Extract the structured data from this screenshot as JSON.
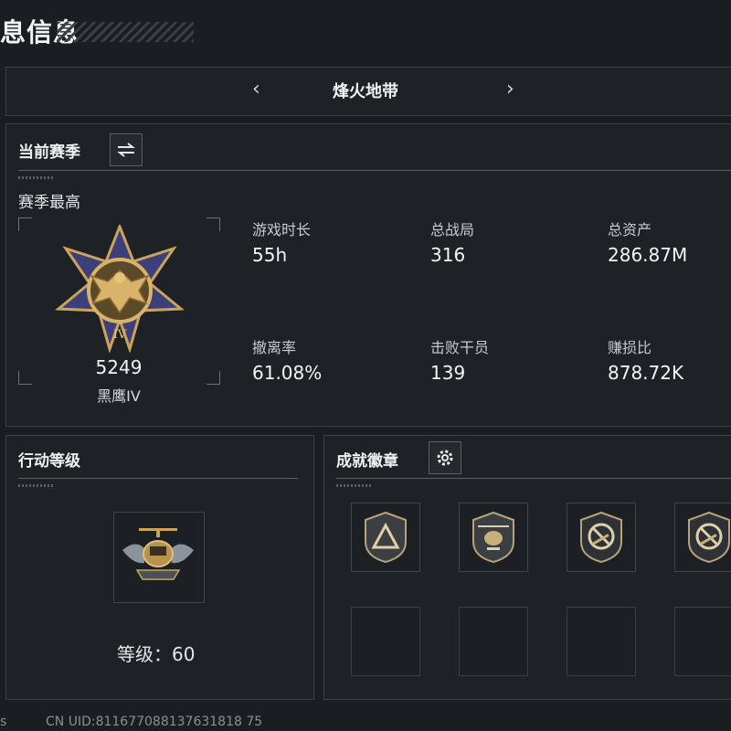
{
  "page": {
    "title": "息信息"
  },
  "mode_nav": {
    "mode_name": "烽火地带",
    "prev": "‹",
    "next": "›"
  },
  "season": {
    "header": "当前赛季",
    "swap_icon": "swap-arrows-icon",
    "best_label": "赛季最高",
    "rank_score": "5249",
    "rank_name": "黑鹰IV",
    "rank_emblem_numeral": "IV",
    "stats": [
      {
        "label": "游戏时长",
        "value": "55h"
      },
      {
        "label": "总战局",
        "value": "316"
      },
      {
        "label": "总资产",
        "value": "286.87M"
      },
      {
        "label": "撤离率",
        "value": "61.08%"
      },
      {
        "label": "击败干员",
        "value": "139"
      },
      {
        "label": "赚损比",
        "value": "878.72K"
      }
    ]
  },
  "action_level": {
    "header": "行动等级",
    "level_label": "等级：",
    "level_value": "60"
  },
  "achievements": {
    "header": "成就徽章",
    "settings_icon": "gear-icon",
    "badges": [
      "triangle-badge-icon",
      "helicopter-badge-icon",
      "no-rifle-badge-icon",
      "no-rifle-badge-icon"
    ]
  },
  "footer": {
    "left_fragment": "s",
    "uid": "CN UID:811677088137631818 75"
  }
}
